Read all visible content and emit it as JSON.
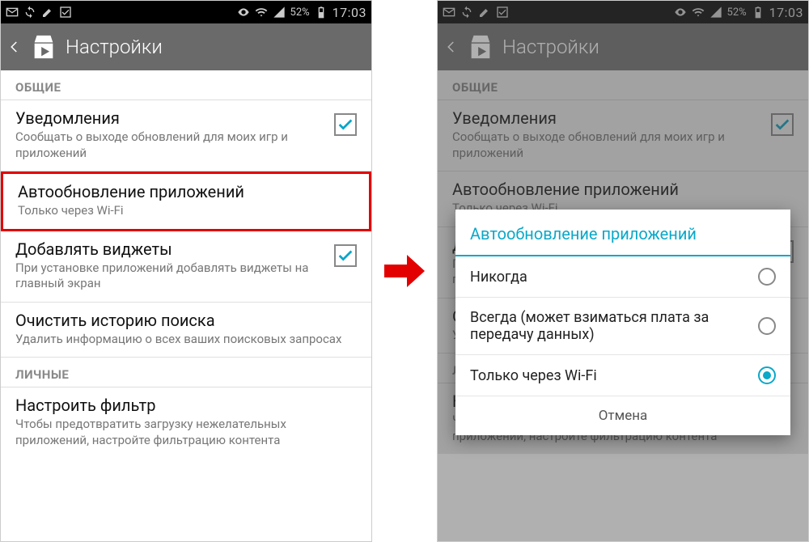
{
  "status": {
    "battery_pct": "52%",
    "clock": "17:03"
  },
  "actionbar": {
    "title": "Настройки"
  },
  "sections": {
    "general": "ОБЩИЕ",
    "personal": "ЛИЧНЫЕ"
  },
  "settings": {
    "notifications": {
      "title": "Уведомления",
      "subtitle": "Сообщать о выходе обновлений для моих игр и приложений"
    },
    "autoupdate": {
      "title": "Автообновление приложений",
      "subtitle": "Только через Wi-Fi"
    },
    "widgets": {
      "title": "Добавлять виджеты",
      "subtitle": "При установке приложений добавлять виджеты на главный экран"
    },
    "clear_history": {
      "title": "Очистить историю поиска",
      "subtitle": "Удалить информацию о всех ваших поисковых запросах"
    },
    "filter": {
      "title": "Настроить фильтр",
      "subtitle": "Чтобы предотвратить загрузку нежелательных приложений, настройте фильтрацию контента"
    }
  },
  "dialog": {
    "title": "Автообновление приложений",
    "options": {
      "never": "Никогда",
      "always": "Всегда (может взиматься плата за передачу данных)",
      "wifi": "Только через Wi-Fi"
    },
    "cancel": "Отмена"
  }
}
